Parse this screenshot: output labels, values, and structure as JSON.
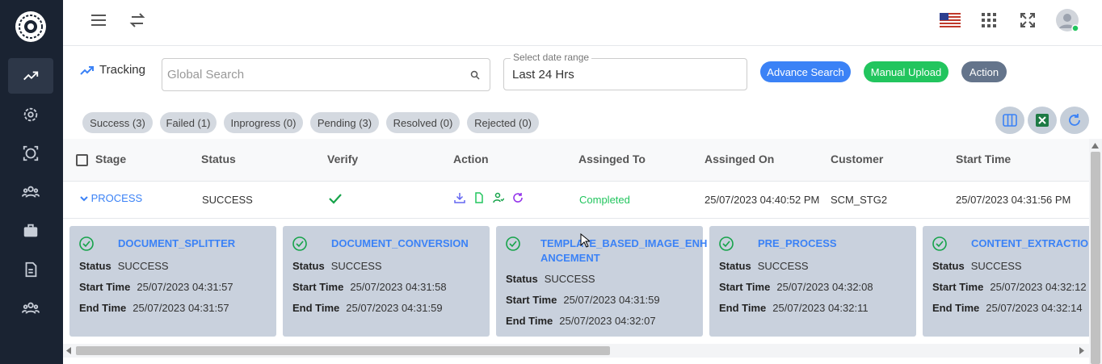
{
  "topbar": {
    "flag_icon": "us-flag-icon"
  },
  "toolbar": {
    "tracking_label": "Tracking",
    "search_placeholder": "Global Search",
    "date_label": "Select date range",
    "date_value": "Last 24 Hrs",
    "advance_search": "Advance Search",
    "manual_upload": "Manual Upload",
    "action": "Action"
  },
  "filters": [
    "Success (3)",
    "Failed (1)",
    "Inprogress (0)",
    "Pending (3)",
    "Resolved (0)",
    "Rejected (0)"
  ],
  "table": {
    "headers": [
      "Stage",
      "Status",
      "Verify",
      "Action",
      "Assinged To",
      "Assinged On",
      "Customer",
      "Start Time"
    ],
    "row": {
      "stage": "PROCESS",
      "status": "SUCCESS",
      "assigned_to": "Completed",
      "assigned_on": "25/07/2023 04:40:52 PM",
      "customer": "SCM_STG2",
      "start_time": "25/07/2023 04:31:56 PM"
    }
  },
  "cards": [
    {
      "title": "DOCUMENT_SPLITTER",
      "status": "SUCCESS",
      "start": "25/07/2023 04:31:57",
      "end": "25/07/2023 04:31:57"
    },
    {
      "title": "DOCUMENT_CONVERSION",
      "status": "SUCCESS",
      "start": "25/07/2023 04:31:58",
      "end": "25/07/2023 04:31:59"
    },
    {
      "title": "TEMPLATE_BASED_IMAGE_ENH",
      "title2": "ANCEMENT",
      "status": "SUCCESS",
      "start": "25/07/2023 04:31:59",
      "end": "25/07/2023 04:32:07"
    },
    {
      "title": "PRE_PROCESS",
      "status": "SUCCESS",
      "start": "25/07/2023 04:32:08",
      "end": "25/07/2023 04:32:11"
    },
    {
      "title": "CONTENT_EXTRACTION",
      "status": "SUCCESS",
      "start": "25/07/2023 04:32:12",
      "end": "25/07/2023 04:32:14"
    }
  ],
  "labels": {
    "status": "Status",
    "start_time": "Start Time",
    "end_time": "End Time"
  },
  "colors": {
    "sidebar": "#1a2332",
    "advance": "#3b82f6",
    "upload": "#22c55e",
    "action": "#64748b",
    "completed": "#22c55e"
  }
}
